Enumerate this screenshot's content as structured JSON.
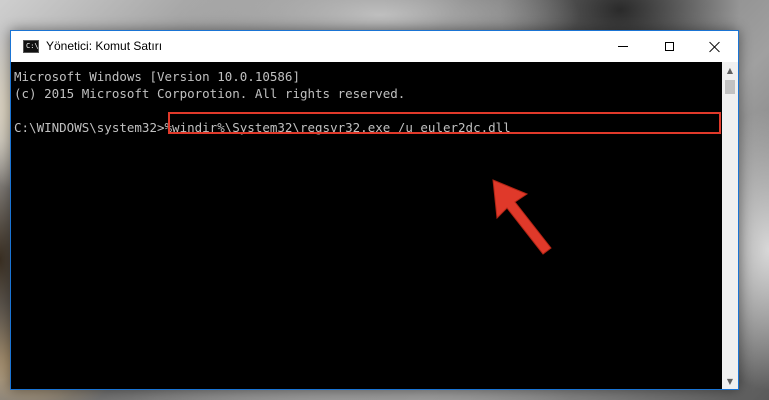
{
  "window": {
    "title": "Yönetici: Komut Satırı",
    "icon_text": "C:\\",
    "controls": {
      "minimize": "minimize-icon",
      "maximize": "maximize-icon",
      "close": "close-icon"
    }
  },
  "console": {
    "line1": "Microsoft Windows [Version 10.0.10586]",
    "line2": "(c) 2015 Microsoft Corporotion. All rights reserved.",
    "prompt": "C:\\WINDOWS\\system32>",
    "command": "%windir%\\System32\\regsvr32.exe /u euler2dc.dll"
  },
  "annotation": {
    "highlight_color": "#e0392a",
    "arrow_color": "#e0392a"
  },
  "scrollbar": {
    "up_icon": "▲",
    "down_icon": "▼"
  }
}
